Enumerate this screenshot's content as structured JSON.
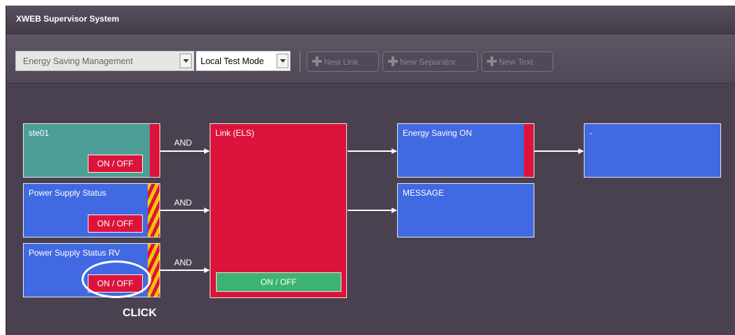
{
  "window": {
    "title": "XWEB Supervisor System"
  },
  "toolbar": {
    "view_select": "Energy Saving Management",
    "mode_select": "Local Test Mode",
    "new_link": "New Link",
    "new_separator": "New Separator",
    "new_text": "New Text"
  },
  "nodes": {
    "ste01": {
      "title": "ste01",
      "button": "ON / OFF"
    },
    "power_supply": {
      "title": "Power Supply Status",
      "button": "ON / OFF"
    },
    "power_supply_rv": {
      "title": "Power Supply Status RV",
      "button": "ON / OFF"
    },
    "link": {
      "title": "Link (ELS)",
      "button": "ON / OFF"
    },
    "energy_saving": {
      "title": "Energy Saving ON"
    },
    "message": {
      "title": "MESSAGE"
    },
    "output": {
      "title": "-"
    }
  },
  "connectors": {
    "and1": "AND",
    "and2": "AND",
    "and3": "AND"
  },
  "annotation": {
    "click": "CLICK"
  },
  "colors": {
    "blue_node": "#4169e1",
    "red_node": "#dc143c",
    "teal_node": "#4d9e96",
    "green_button": "#3cb371",
    "stripe_yellow": "#f5c500",
    "background": "#4a4150"
  }
}
